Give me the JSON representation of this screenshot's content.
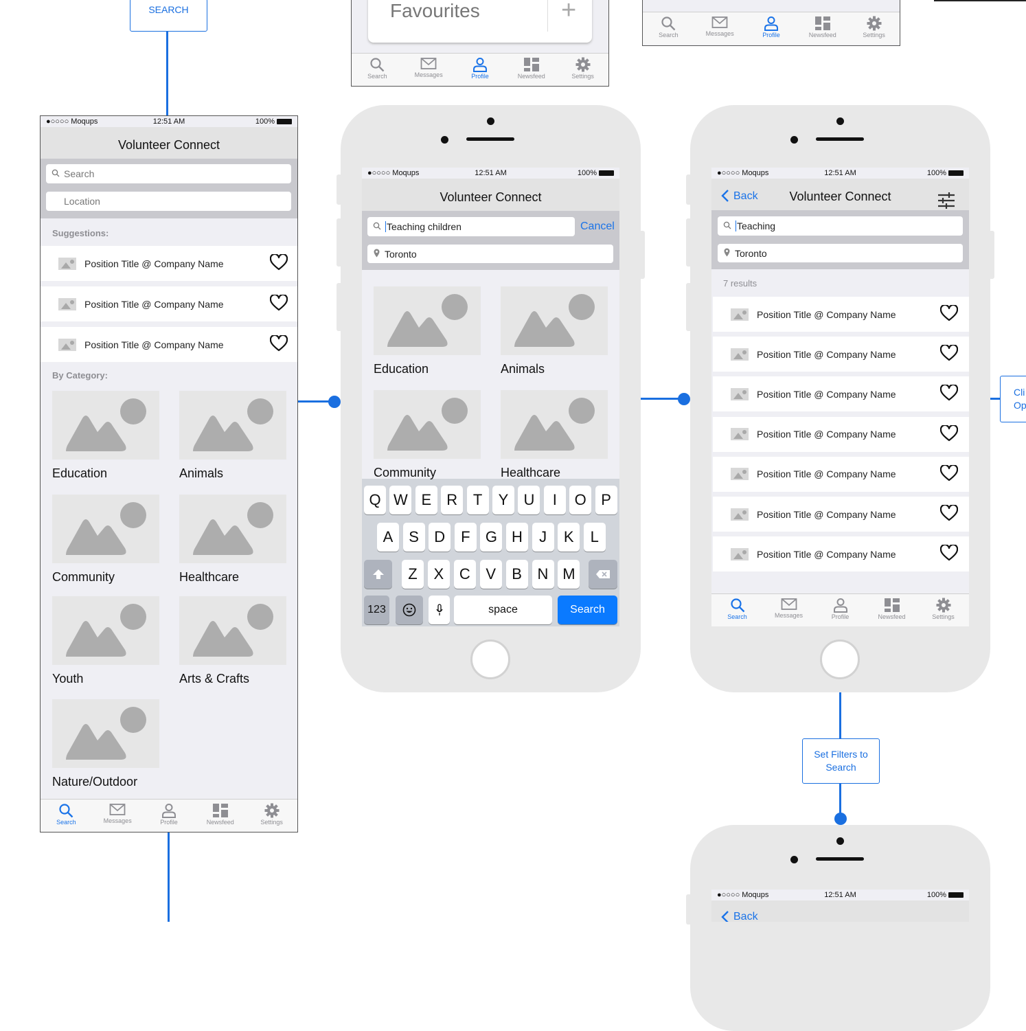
{
  "flow": {
    "search_box": "SEARCH",
    "set_filters_box": "Set Filters to Search",
    "clipped_box": "Cli\nOp"
  },
  "status": {
    "carrier": "●○○○○ Moqups",
    "time": "12:51 AM",
    "battery": "100%"
  },
  "app_title": "Volunteer Connect",
  "tabs": [
    "Search",
    "Messages",
    "Profile",
    "Newsfeed",
    "Settings"
  ],
  "top_fragment": {
    "favourites": "Favourites"
  },
  "screen1": {
    "search_placeholder": "Search",
    "location_placeholder": "Location",
    "suggestions_header": "Suggestions:",
    "suggestions": [
      "Position Title @ Company Name",
      "Position Title @ Company Name",
      "Position Title @ Company Name"
    ],
    "category_header": "By Category:",
    "categories": [
      "Education",
      "Animals",
      "Community",
      "Healthcare",
      "Youth",
      "Arts & Crafts",
      "Nature/Outdoor"
    ]
  },
  "screen2": {
    "search_value": "Teaching children",
    "cancel": "Cancel",
    "location_value": "Toronto",
    "categories": [
      "Education",
      "Animals",
      "Community",
      "Healthcare"
    ],
    "keyboard": {
      "row1": [
        "Q",
        "W",
        "E",
        "R",
        "T",
        "Y",
        "U",
        "I",
        "O",
        "P"
      ],
      "row2": [
        "A",
        "S",
        "D",
        "F",
        "G",
        "H",
        "J",
        "K",
        "L"
      ],
      "row3": [
        "Z",
        "X",
        "C",
        "V",
        "B",
        "N",
        "M"
      ],
      "num": "123",
      "space": "space",
      "search": "Search"
    }
  },
  "screen3": {
    "back": "Back",
    "search_value": "Teaching",
    "location_value": "Toronto",
    "results_count": "7 results",
    "results": [
      "Position Title @ Company Name",
      "Position Title @ Company Name",
      "Position Title @ Company Name",
      "Position Title @ Company Name",
      "Position Title @ Company Name",
      "Position Title @ Company Name",
      "Position Title @ Company Name"
    ]
  },
  "screen4": {
    "back": "Back"
  },
  "colors": {
    "accent": "#1a73e8",
    "flow_line": "#1a6fe0"
  }
}
